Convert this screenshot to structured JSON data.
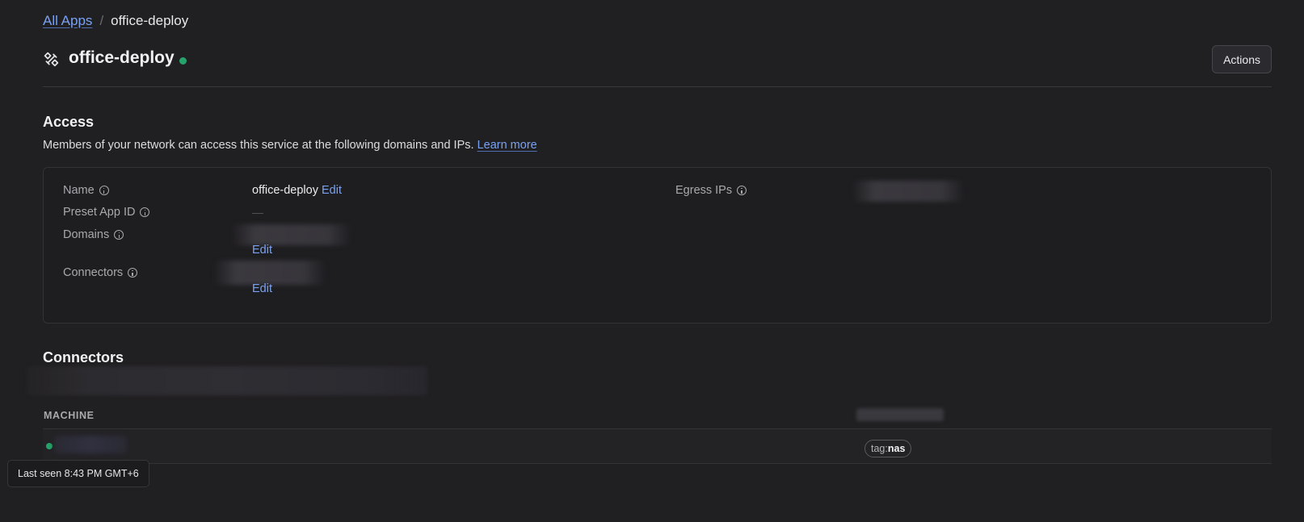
{
  "breadcrumb": {
    "root": "All Apps",
    "separator": "/",
    "current": "office-deploy"
  },
  "header": {
    "title": "office-deploy",
    "icon": "tools-icon",
    "status_color": "#25a36b",
    "actions_label": "Actions"
  },
  "access": {
    "title": "Access",
    "description": "Members of your network can access this service at the following domains and IPs.",
    "learn_more": "Learn more",
    "fields": {
      "name_label": "Name",
      "name_value": "office-deploy",
      "preset_label": "Preset App ID",
      "preset_value": "—",
      "domains_label": "Domains",
      "connectors_label": "Connectors",
      "egress_label": "Egress IPs",
      "edit_label": "Edit"
    }
  },
  "connectors": {
    "title": "Connectors",
    "columns": {
      "machine": "MACHINE"
    },
    "rows": [
      {
        "tag_prefix": "tag:",
        "tag_value": "nas"
      }
    ]
  },
  "tooltip": {
    "text": "Last seen 8:43 PM GMT+6"
  },
  "colors": {
    "accent": "#7aa2f2",
    "online": "#25a36b",
    "background": "#201f21"
  }
}
